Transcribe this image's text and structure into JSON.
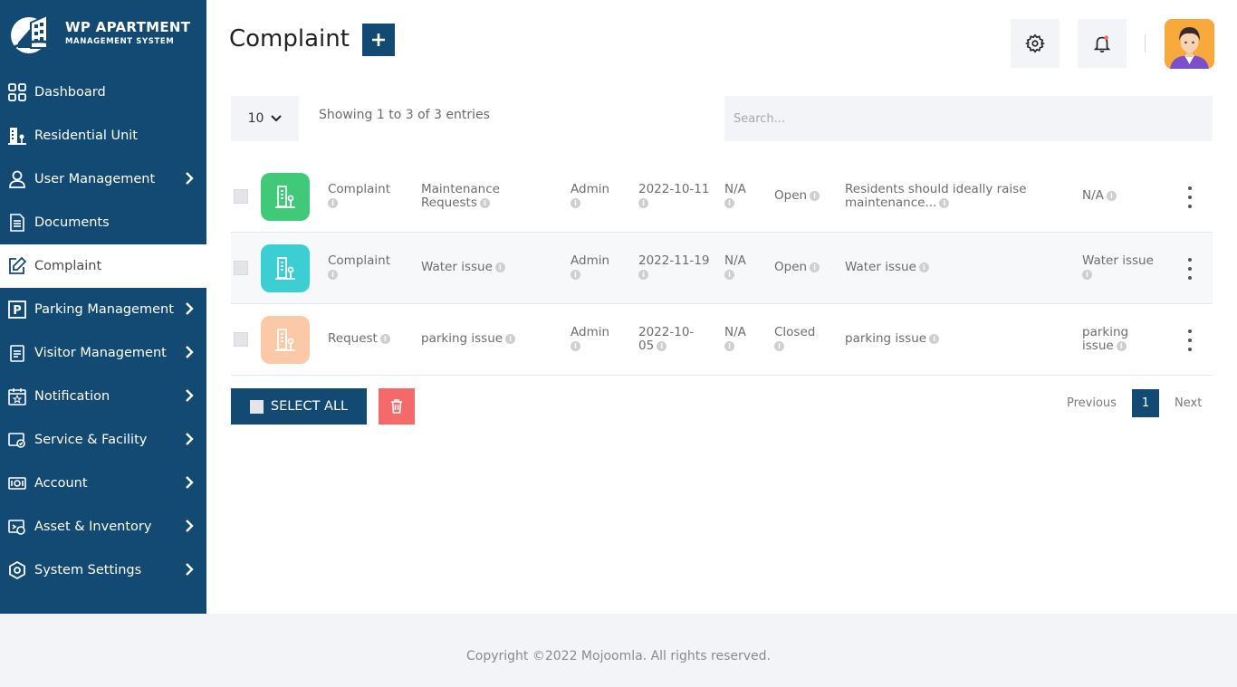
{
  "brand": {
    "title": "WP APARTMENT",
    "subtitle": "MANAGEMENT SYSTEM"
  },
  "sidebar": {
    "items": [
      {
        "label": "Dashboard",
        "icon": "grid-icon",
        "has_submenu": false,
        "active": false
      },
      {
        "label": "Residential Unit",
        "icon": "building-icon",
        "has_submenu": false,
        "active": false
      },
      {
        "label": "User Management",
        "icon": "user-icon",
        "has_submenu": true,
        "active": false
      },
      {
        "label": "Documents",
        "icon": "document-icon",
        "has_submenu": false,
        "active": false
      },
      {
        "label": "Complaint",
        "icon": "edit-icon",
        "has_submenu": false,
        "active": true
      },
      {
        "label": "Parking Management",
        "icon": "parking-icon",
        "has_submenu": true,
        "active": false
      },
      {
        "label": "Visitor Management",
        "icon": "clipboard-icon",
        "has_submenu": true,
        "active": false
      },
      {
        "label": "Notification",
        "icon": "calendar-star-icon",
        "has_submenu": true,
        "active": false
      },
      {
        "label": "Service & Facility",
        "icon": "service-icon",
        "has_submenu": true,
        "active": false
      },
      {
        "label": "Account",
        "icon": "money-icon",
        "has_submenu": true,
        "active": false
      },
      {
        "label": "Asset & Inventory",
        "icon": "inventory-icon",
        "has_submenu": true,
        "active": false
      },
      {
        "label": "System Settings",
        "icon": "settings-icon",
        "has_submenu": true,
        "active": false
      }
    ]
  },
  "header": {
    "title": "Complaint",
    "add_icon": "plus-icon",
    "settings_icon": "gear-icon",
    "notification_icon": "bell-icon"
  },
  "controls": {
    "page_size": "10",
    "showing": "Showing 1 to 3 of 3 entries",
    "search_placeholder": "Search..."
  },
  "rows": [
    {
      "icon_color": "#3fc978",
      "type": "Complaint",
      "category": "Maintenance Requests",
      "created_by": "Admin",
      "date": "2022-10-11",
      "assigned": "N/A",
      "status": "Open",
      "description": "Residents should ideally raise maintenance...",
      "resolution": "N/A"
    },
    {
      "icon_color": "#3bcfd4",
      "type": "Complaint",
      "category": "Water issue",
      "created_by": "Admin",
      "date": "2022-11-19",
      "assigned": "N/A",
      "status": "Open",
      "description": "Water issue",
      "resolution": "Water issue"
    },
    {
      "icon_color": "#fcc9a8",
      "type": "Request",
      "category": "parking issue",
      "created_by": "Admin",
      "date": "2022-10-05",
      "assigned": "N/A",
      "status": "Closed",
      "description": "parking issue",
      "resolution": "parking issue"
    }
  ],
  "actions": {
    "select_all": "SELECT ALL",
    "delete_icon": "trash-icon"
  },
  "pagination": {
    "previous": "Previous",
    "current": "1",
    "next": "Next"
  },
  "footer": {
    "copyright": "Copyright ©2022 Mojoomla. All rights reserved."
  },
  "colors": {
    "primary": "#134a73",
    "danger": "#f46a6a",
    "light_bg": "#f2f4f8"
  }
}
